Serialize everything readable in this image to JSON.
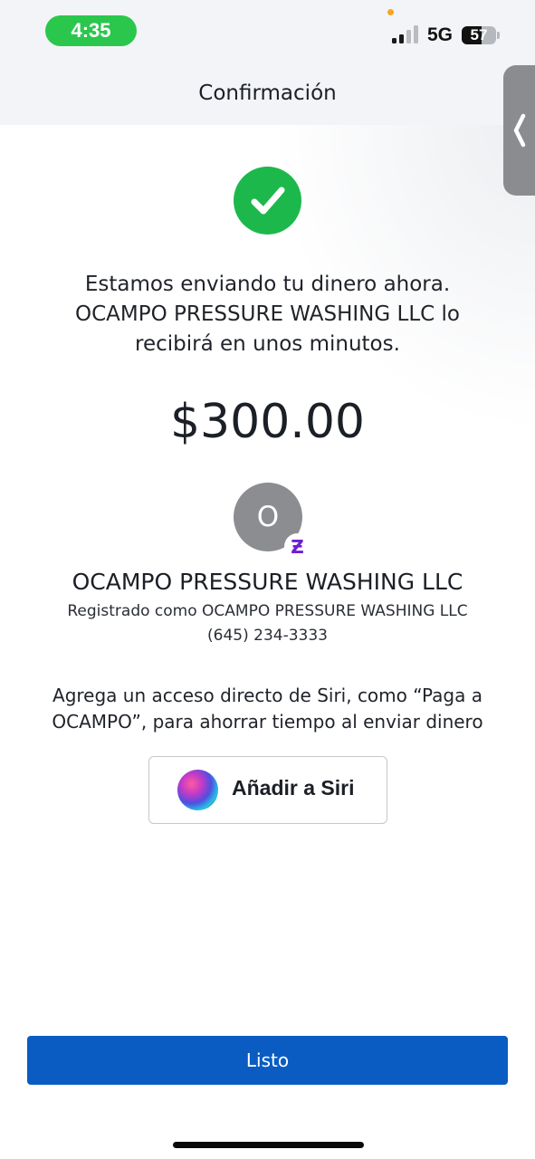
{
  "status_bar": {
    "time": "4:35",
    "network": "5G",
    "battery_level": "57",
    "battery_fraction": 0.57
  },
  "header": {
    "title": "Confirmación"
  },
  "confirmation": {
    "message": "Estamos enviando tu dinero ahora. OCAMPO PRESSURE WASHING LLC lo recibirá en unos minutos.",
    "amount": "$300.00"
  },
  "recipient": {
    "avatar_initial": "O",
    "badge_symbol": "Ƶ",
    "name": "OCAMPO PRESSURE WASHING LLC",
    "registered_as": "Registrado como OCAMPO PRESSURE WASHING LLC",
    "phone": "(645) 234-3333"
  },
  "siri": {
    "description": "Agrega un acceso directo de Siri, como “Paga a OCAMPO”, para ahorrar tiempo al enviar dinero",
    "button_label": "Añadir a Siri"
  },
  "footer": {
    "done_label": "Listo"
  },
  "colors": {
    "success_green": "#1db84c",
    "time_pill_green": "#2bc74d",
    "primary_blue": "#0a5cc2",
    "zelle_purple": "#6d1ed4",
    "avatar_gray": "#8b8d91"
  },
  "icons": [
    "check-icon",
    "chevron-left-icon",
    "siri-icon",
    "zelle-icon",
    "signal-icon",
    "battery-icon"
  ]
}
